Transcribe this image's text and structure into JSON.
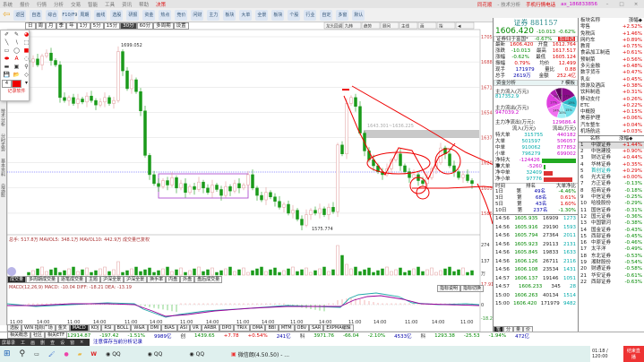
{
  "titlebar": {
    "menus": [
      "系统",
      "报价",
      "行情",
      "分析",
      "交易",
      "智能",
      "工具",
      "资讯",
      "帮助"
    ],
    "brand": "决策",
    "app": "同花顺",
    "title": "- 技术分析",
    "account": "手机行情电话",
    "user": "ax_186833856"
  },
  "toolbar": {
    "items": [
      "返回",
      "自选",
      "综合",
      "F10/F9",
      "周期",
      "画线",
      "选股",
      "研报",
      "资金",
      "热点",
      "竞价",
      "问财",
      "主力",
      "板块",
      "大单",
      "全景",
      "板块",
      "个股",
      "行业",
      "自定",
      "多窗",
      "默认"
    ]
  },
  "periods": [
    "日",
    "周",
    "月",
    "季",
    "年",
    "1分",
    "5分",
    "15分",
    "30分",
    "60分",
    "多周期",
    "设置"
  ],
  "periods_selected": "30分",
  "palette": {
    "label": "记录软件",
    "width_value": "4"
  },
  "left_tabs": [
    "技术分析",
    "分时走势",
    "基本资料",
    "自选股"
  ],
  "price_chart": {
    "symbol_label": "证券",
    "y_ticks": [
      1705,
      1688,
      1671,
      1654,
      1637,
      1620,
      1603,
      1586
    ],
    "high_label": "1699.052",
    "low_label": "1575.774",
    "zone_label": "1643.301~1636.225",
    "closes": [
      1688,
      1690,
      1686,
      1692,
      1694,
      1689,
      1686,
      1664,
      1662,
      1664,
      1660,
      1663,
      1661,
      1665,
      1662,
      1659,
      1661,
      1664,
      1660,
      1662,
      1695,
      1682,
      1670,
      1676,
      1668,
      1655,
      1625,
      1612,
      1606,
      1604,
      1608,
      1605,
      1610,
      1603,
      1606,
      1600,
      1604,
      1602,
      1607,
      1603,
      1600,
      1605,
      1602,
      1598,
      1604,
      1601,
      1606,
      1603,
      1605,
      1612,
      1603,
      1598,
      1595,
      1600,
      1597,
      1594,
      1590,
      1592,
      1586,
      1588,
      1582,
      1578,
      1585,
      1588,
      1586,
      1589,
      1585,
      1590,
      1587,
      1632,
      1626,
      1660,
      1664,
      1658,
      1640,
      1628,
      1622,
      1618,
      1614,
      1612,
      1616,
      1622,
      1626,
      1618,
      1614,
      1610,
      1612,
      1608,
      1606,
      1610,
      1616,
      1620,
      1630,
      1626,
      1618,
      1614,
      1610,
      1612,
      1608,
      1606
    ],
    "up_color": "#e09a9a",
    "down_color": "#1a9a1a"
  },
  "chart_tools": [
    "龙头回调",
    "九转",
    "趋势",
    "顾问",
    "主线",
    "画",
    "指",
    "◀"
  ],
  "volume": {
    "header": "总手: 517.8万  MAVOL5: 348.1万  MAVOL10: 442.9万  成交量已复权",
    "y_ticks": [
      "274",
      "137",
      "万"
    ],
    "tabs": [
      "成交量",
      "多周期成交量",
      "逐笔成交量",
      "主题",
      "沪深全景",
      "沪深全景",
      "换手率",
      "内盘",
      "外盘",
      "盘后成交量"
    ]
  },
  "macd": {
    "header": "MACD(12,26,9)  MACD: -10.04  DIFF: -18.21  DEA: -13.19",
    "y_ticks": [
      "17.91",
      "0",
      "-18.24"
    ],
    "buttons": [
      "指标说明",
      "指标切换"
    ]
  },
  "time_axis": [
    "11:00",
    "14:00",
    "11:00",
    "14:00",
    "11:00",
    "14:00",
    "11:00",
    "14:00",
    "11:00",
    "14:00",
    "11:00",
    "14:00",
    "11:00",
    "14:00",
    "11:00",
    "14:00",
    "11:00"
  ],
  "indicator_tabs": [
    "选股",
    "WIN 指标广场",
    "金叉",
    "MACD",
    "KDJ",
    "RSI",
    "BOLL",
    "W&R",
    "DMI",
    "BIAS",
    "ASI",
    "VR",
    "ARBR",
    "DPO",
    "TRIX",
    "DMA",
    "BBI",
    "MTM",
    "OBV",
    "SAR",
    "EXPMA编辑"
  ],
  "indicator_selected": "MACD",
  "bottom_tabs": [
    "相关概念",
    "社区",
    "相关ETF"
  ],
  "quote": {
    "name": "证券 881157",
    "price": "1606.420",
    "change": "-10.013",
    "pct": "-0.62%",
    "sub_name": "证券归于富国*",
    "sub_pct": "-0.67%",
    "add_button": "加自选",
    "rows": [
      [
        "最新",
        "1606.420",
        "开盘",
        "1612.764"
      ],
      [
        "涨跌",
        "-10.013",
        "最高",
        "1617.517"
      ],
      [
        "涨幅",
        "-0.62%",
        "最低",
        "1605.124"
      ],
      [
        "振幅",
        "0.79%",
        "均价",
        "12.499"
      ],
      [
        "现手",
        "171979",
        "量比",
        "0.88"
      ],
      [
        "总手",
        "2619万",
        "金额",
        "252.4亿"
      ]
    ],
    "fund_tab": "资金分析",
    "fund_btn": "? 模板",
    "inflow_label": "主力流入(万元)",
    "inflow": "817352.9",
    "outflow_label": "主力流出(万元)",
    "outflow": "947039.2",
    "net_label": "主力净流出(万元):",
    "net": "129686.4",
    "pie": [
      {
        "label": "17%",
        "value": 17,
        "color": "#8a0a8a"
      },
      {
        "label": "13%",
        "value": 13,
        "color": "#2ab8c8"
      },
      {
        "label": "15%",
        "value": 15,
        "color": "#70e0ea"
      },
      {
        "label": "10%",
        "value": 10,
        "color": "#a0f0f4"
      },
      {
        "label": "14%",
        "value": 14,
        "color": "#f070f0"
      },
      {
        "label": "17%",
        "value": 17,
        "color": "#e040e0"
      },
      {
        "label": "7%",
        "value": 7,
        "color": "#b020b0"
      },
      {
        "label": "7%",
        "value": 7,
        "color": "#5a005a"
      }
    ],
    "flow_headers": [
      "流入(万元)",
      "流出(万元)"
    ],
    "flows": [
      [
        "特大单",
        "315755",
        "440182"
      ],
      [
        "大单",
        "501597",
        "506057"
      ],
      [
        "中单",
        "910062",
        "877852"
      ],
      [
        "小单",
        "796279",
        "699002"
      ]
    ],
    "nets": [
      {
        "label": "净特大单",
        "value": "-124426",
        "frac": -1.0
      },
      {
        "label": "净大单",
        "value": "-5260",
        "frac": -0.04
      },
      {
        "label": "净中单",
        "value": "32409",
        "frac": 0.26
      },
      {
        "label": "净小单",
        "value": "97776",
        "frac": 0.79
      }
    ],
    "rank_headers": [
      "时间",
      "排名",
      "大单净比"
    ],
    "ranks": [
      [
        "1日",
        "第",
        "49名",
        "-4.46%"
      ],
      [
        "3日",
        "第",
        "68名",
        "0.61%"
      ],
      [
        "5日",
        "第",
        "43名",
        "1.60%"
      ],
      [
        "10日",
        "第",
        "237名",
        "-1.30%"
      ]
    ],
    "ticks": [
      [
        "14:56",
        "1605.935",
        "16909",
        "1273"
      ],
      [
        "14:56",
        "1605.916",
        "29190",
        "1593"
      ],
      [
        "14:56",
        "1605.794",
        "27364",
        "2011"
      ],
      [
        "14:56",
        "1605.923",
        "29113",
        "2131"
      ],
      [
        "14:56",
        "1605.845",
        "19833",
        "1633"
      ],
      [
        "14:56",
        "1606.126",
        "26711",
        "2116"
      ],
      [
        "14:56",
        "1606.108",
        "23534",
        "1431"
      ],
      [
        "14:57",
        "1606.137",
        "19146",
        "1051"
      ],
      [
        "14:57",
        "1606.233",
        "345",
        "28"
      ],
      [
        "15:00",
        "1606.263",
        "40134",
        "1514"
      ],
      [
        "15:00",
        "1606.420",
        "171979",
        "9482"
      ]
    ],
    "tick_tabs": [
      "笔",
      "分",
      "量",
      "价"
    ]
  },
  "sectors": {
    "header": [
      "板块名称",
      "涨幅◆"
    ],
    "items": [
      [
        "零售",
        "+2.52%"
      ],
      [
        "免税店",
        "+1.46%"
      ],
      [
        "网约车",
        "+0.89%"
      ],
      [
        "教育",
        "+0.75%"
      ],
      [
        "食品加工制造",
        "+0.61%"
      ],
      [
        "预制菜",
        "+0.56%"
      ],
      [
        "多元金融",
        "+0.48%"
      ],
      [
        "数字货币",
        "+0.47%"
      ],
      [
        "乳业",
        "+0.45%"
      ],
      [
        "旅游及酒店",
        "+0.38%"
      ],
      [
        "饮料制造",
        "+0.31%"
      ],
      [
        "移动支付",
        "+0.26%"
      ],
      [
        "ETC",
        "+0.22%"
      ],
      [
        "中概股",
        "+0.15%"
      ],
      [
        "美容护理",
        "+0.06%"
      ],
      [
        "汽车整车",
        "+0.04%"
      ],
      [
        "机场航运",
        "+0.03%"
      ]
    ]
  },
  "stocks": {
    "header": [
      "名称",
      "涨幅◆"
    ],
    "items": [
      [
        "1",
        "中银证券",
        "+1.44%"
      ],
      [
        "2",
        "中信建投",
        "+0.90%"
      ],
      [
        "3",
        "财达证券",
        "+0.44%"
      ],
      [
        "4",
        "华林证券",
        "+0.35%"
      ],
      [
        "5",
        "首创证券",
        "+0.29%"
      ],
      [
        "6",
        "光大证券",
        "+0.00%"
      ],
      [
        "7",
        "方正证券",
        "-0.13%"
      ],
      [
        "8",
        "招商证券",
        "-0.18%"
      ],
      [
        "9",
        "中信证券",
        "-0.25%"
      ],
      [
        "10",
        "哈投股份",
        "-0.29%"
      ],
      [
        "11",
        "国信证券",
        "-0.31%"
      ],
      [
        "12",
        "国元证券",
        "-0.36%"
      ],
      [
        "13",
        "中国银河",
        "-0.38%"
      ],
      [
        "14",
        "国金证券",
        "-0.43%"
      ],
      [
        "15",
        "西部证券",
        "-0.45%"
      ],
      [
        "16",
        "中原证券",
        "-0.46%"
      ],
      [
        "17",
        "太平洋",
        "-0.49%"
      ],
      [
        "18",
        "东北证券",
        "-0.53%"
      ],
      [
        "19",
        "湘财股份",
        "-0.54%"
      ],
      [
        "20",
        "财通证券",
        "-0.58%"
      ],
      [
        "21",
        "华安证券",
        "-0.61%"
      ],
      [
        "22",
        "西部证券",
        "-0.63%"
      ]
    ]
  },
  "strip": [
    [
      "",
      "7333亿"
    ],
    [
      "深",
      "12914.87",
      "-197.42",
      "-1.51%",
      "9989亿"
    ],
    [
      "创",
      "1439.65",
      "+7.78",
      "+0.54%",
      "241亿"
    ],
    [
      "科",
      "3971.76",
      "-66.04",
      "-2.10%",
      "4533亿"
    ],
    [
      "科",
      "1293.38",
      "-25.53",
      "-1.94%",
      "472亿"
    ]
  ],
  "recbar": [
    "屏幕录",
    "工",
    "画",
    "删",
    "查",
    "设",
    "窗",
    "×"
  ],
  "notice": "注意保存当前分析记录",
  "taskbar": {
    "apps": [
      "QQ",
      "QQ",
      "QQ",
      "微信朗(4.50.50) - ..."
    ],
    "timer": "01:18 / 120:00",
    "end_button": "结束直播"
  }
}
